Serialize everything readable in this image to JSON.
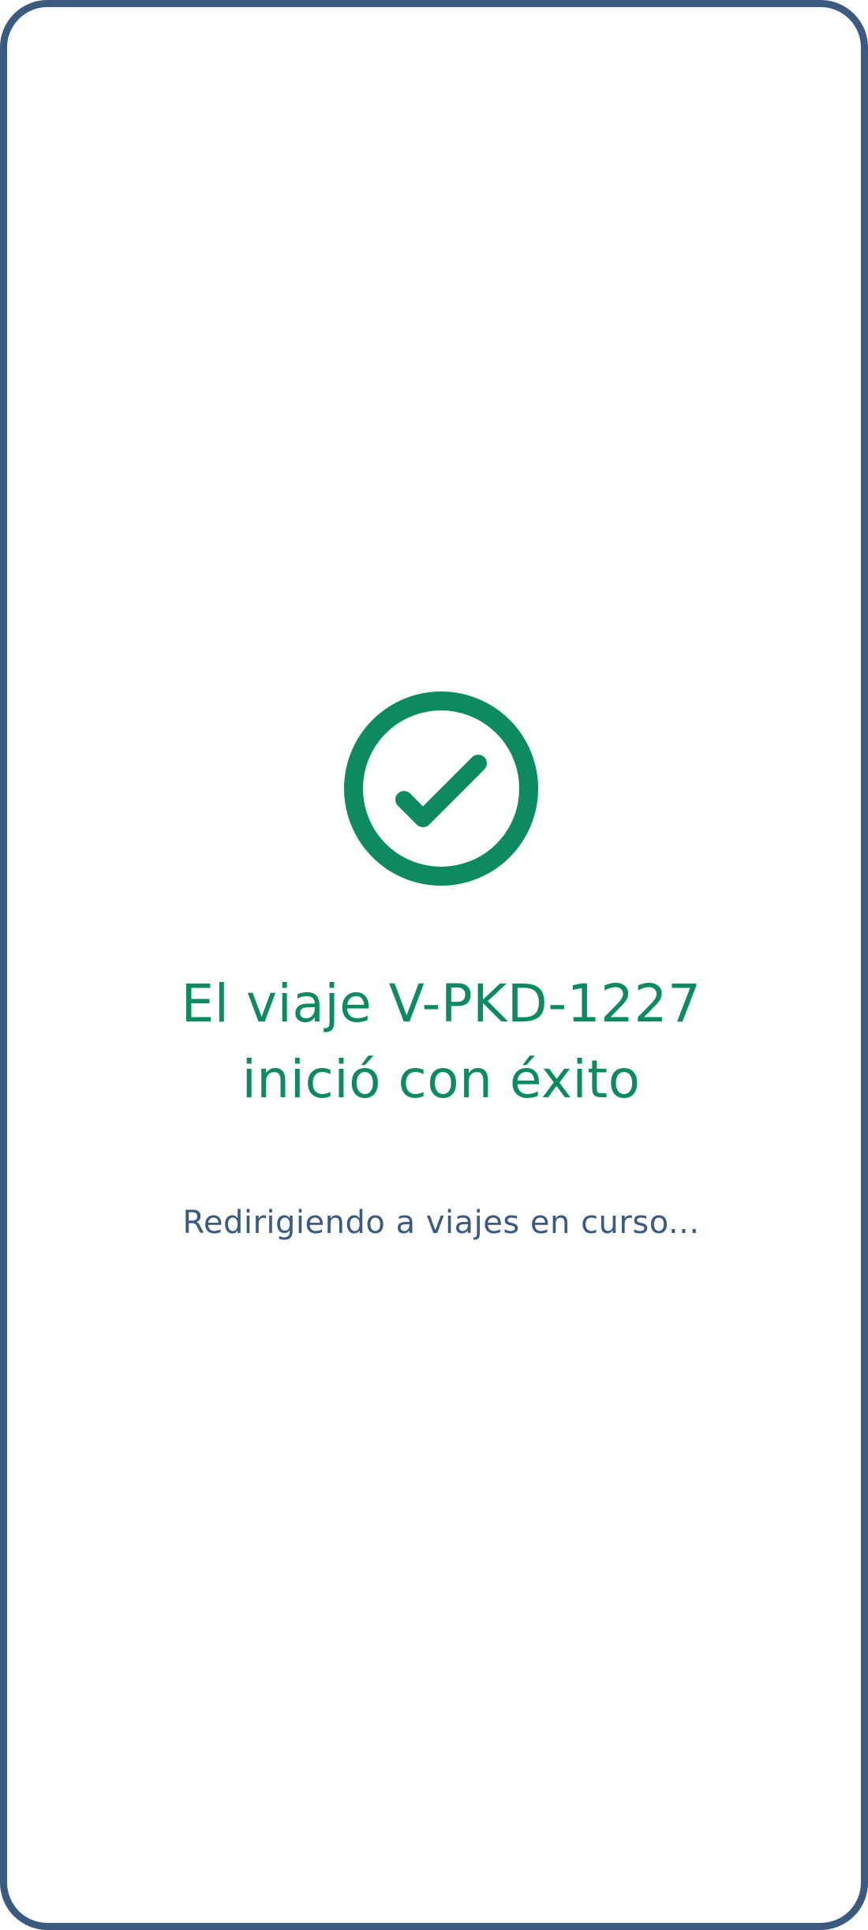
{
  "success_screen": {
    "icon": "check-circle-icon",
    "title_line1": "El viaje V-PKD-1227",
    "title_line2": "inició con éxito",
    "subtitle": "Redirigiendo a viajes en curso..."
  },
  "colors": {
    "accent_green": "#0d8a5e",
    "frame_blue": "#3b5a80",
    "background": "#ffffff"
  }
}
